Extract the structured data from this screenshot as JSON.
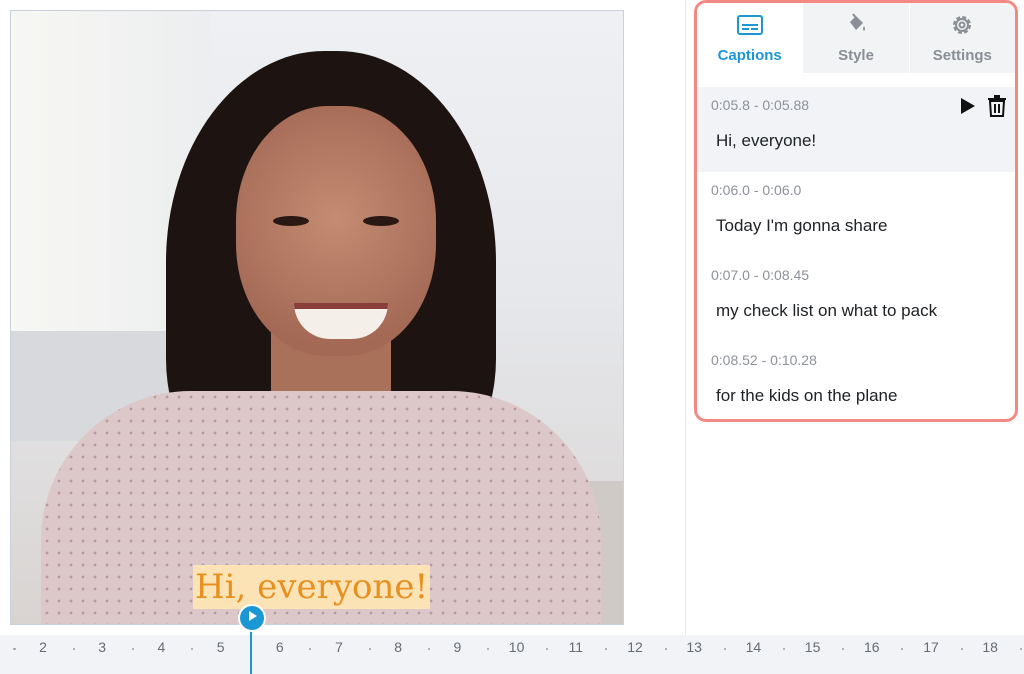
{
  "video": {
    "caption_overlay": "Hi, everyone!"
  },
  "tabs": [
    {
      "label": "Captions",
      "icon": "captions-icon",
      "active": true
    },
    {
      "label": "Style",
      "icon": "paint-bucket-icon",
      "active": false
    },
    {
      "label": "Settings",
      "icon": "gear-icon",
      "active": false
    }
  ],
  "captions": [
    {
      "time": "0:05.8 - 0:05.88",
      "text": "Hi, everyone!",
      "active": true
    },
    {
      "time": "0:06.0 - 0:06.0",
      "text": "Today I'm gonna share",
      "active": false
    },
    {
      "time": "0:07.0 - 0:08.45",
      "text": "my check list on what to pack",
      "active": false
    },
    {
      "time": "0:08.52 - 0:10.28",
      "text": "for the kids on the plane",
      "active": false
    }
  ],
  "timeline": {
    "ticks": [
      "2",
      "3",
      "4",
      "5",
      "6",
      "7",
      "8",
      "9",
      "10",
      "11",
      "12",
      "13",
      "14",
      "15",
      "16",
      "17",
      "18"
    ],
    "playhead_time": 5.5
  },
  "colors": {
    "accent": "#1b97d3",
    "panel_border": "#f28a83",
    "caption_text": "#e8901f",
    "caption_bg": "#fbe3b6"
  }
}
